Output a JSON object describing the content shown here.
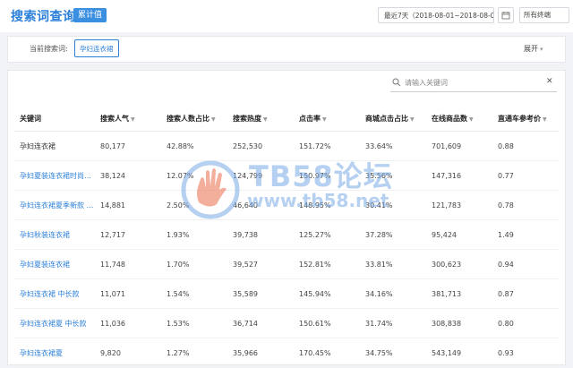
{
  "header": {
    "title": "搜索词查询",
    "badge": "累计值",
    "date_range": "最近7天（2018-08-01~2018-08-07）",
    "device": "所有终端"
  },
  "filter": {
    "label": "当前搜索词:",
    "current": "孕妇连衣裙",
    "expand": "展开"
  },
  "search": {
    "placeholder": "请输入关键词"
  },
  "table": {
    "headers": [
      "关键词",
      "搜索人气",
      "搜索人数占比",
      "搜索热度",
      "点击率",
      "商城点击占比",
      "在线商品数",
      "直通车参考价"
    ],
    "rows": [
      [
        "孕妇连衣裙",
        "80,177",
        "42.88%",
        "252,530",
        "151.72%",
        "33.64%",
        "701,609",
        "0.88"
      ],
      [
        "孕妇夏装连衣裙时尚款...",
        "38,124",
        "12.07%",
        "124,799",
        "150.97%",
        "35.56%",
        "147,316",
        "0.77"
      ],
      [
        "孕妇连衣裙夏季新款 2...",
        "14,881",
        "2.50%",
        "46,640",
        "148.95%",
        "30.41%",
        "121,783",
        "0.78"
      ],
      [
        "孕妇秋装连衣裙",
        "12,717",
        "1.93%",
        "39,738",
        "125.27%",
        "37.28%",
        "95,424",
        "1.49"
      ],
      [
        "孕妇夏装连衣裙",
        "11,748",
        "1.70%",
        "39,527",
        "152.81%",
        "33.81%",
        "300,623",
        "0.94"
      ],
      [
        "孕妇连衣裙 中长款",
        "11,071",
        "1.54%",
        "35,589",
        "145.94%",
        "34.16%",
        "381,713",
        "0.87"
      ],
      [
        "孕妇连衣裙夏 中长款",
        "11,036",
        "1.53%",
        "36,714",
        "150.61%",
        "31.74%",
        "308,838",
        "0.80"
      ],
      [
        "孕妇连衣裙夏",
        "9,820",
        "1.27%",
        "35,966",
        "170.45%",
        "34.75%",
        "543,149",
        "0.93"
      ]
    ]
  },
  "watermark": {
    "title": "TB58论坛",
    "url": "www.tb58.net"
  },
  "colors": {
    "accent": "#2b7fd9",
    "watermark": "#78aae6"
  }
}
